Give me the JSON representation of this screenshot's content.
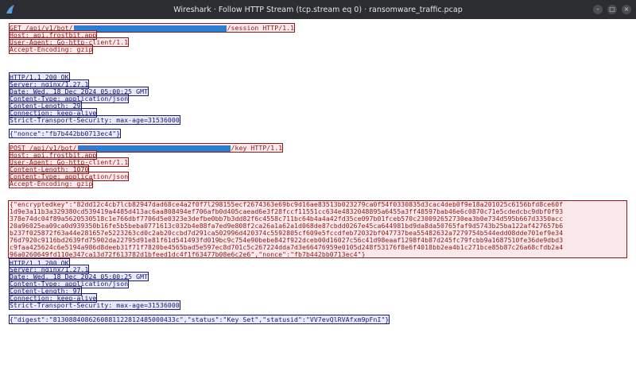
{
  "window": {
    "title": "Wireshark · Follow HTTP Stream (tcp.stream eq 0) · ransomware_traffic.pcap"
  },
  "req1": {
    "method_path_prefix": "GET /api/v1/bot/",
    "method_path_suffix": "/session HTTP/1.1",
    "host": "Host: api.frostbit.app",
    "ua": "User-Agent: Go-http-client/1.1",
    "enc": "Accept-Encoding: gzip"
  },
  "resp1": {
    "status": "HTTP/1.1 200 OK",
    "server": "Server: nginx/1.27.1",
    "date": "Date: Wed, 18 Dec 2024 05:00:25 GMT",
    "ctype": "Content-Type: application/json",
    "clen": "Content-Length: 29",
    "conn": "Connection: keep-alive",
    "sts": "Strict-Transport-Security: max-age=31536000",
    "body": "{\"nonce\":\"fb7b442bb0713ec4\"}"
  },
  "req2": {
    "method_path_prefix": "POST /api/v1/bot/",
    "method_path_suffix": "/key HTTP/1.1",
    "host": "Host: api.frostbit.app",
    "ua": "User-Agent: Go-http-client/1.1",
    "clen": "Content-Length: 1070",
    "ctype": "Content-Type: application/json",
    "enc": "Accept-Encoding: gzip",
    "body_lines": [
      "{\"encryptedkey\":\"82dd12c4cb7lcb82947dad68ce4a2f0f7l298155ecf2674363e69bc9d16ae83513b023279ca0f54f0330835d3cac4deb0f9e18a201025c6156bfd8ce60f",
      "1d9e3a11b3a329380cd539419a4485d413ac6aa808494ef706afb0d405caead6e3f28fccf11551cc634e4832048895a6455a3ff48597bab46e6c0870c71e5cdedcbc9dbf0f93",
      "378e74dc04f89a5620530518c1e766dbf7706d5e0323e3defbe0bb7b3dd82f6c4558c711bc64b4a4a42fd35ce097b01fceb570c230092652730ea3b0e734d595b667d3350acc",
      "20a96025ea09ca0d939350b16fe5b5beba0771613c032b4e88fa7ed9e808f2ca26a1a62a1d068de87cbdd0267e45ca644981bd9da8da50765faf9d5743b25ba122af427657b6",
      "b237f025872f63a44e281657e5223263cd0c2ab20ccbd7d291ca502996d420374c5592805cf609e5fccdfeb72032bf047737bea55482632a7279754b544edd08dde701ef9e34",
      "76d7920c9116bd2639fd75902da22795d91e81f61d541493fd019bc9c754e90bebe842f922dceb00d16027c56c41d98eaaf1298f4b87d245fc79fcbb9a1687510fe36de9dbd3",
      "c9faa425624c6e5194a986d8deeb31f71f7820be4565bad5e597ec8d701c5c267224dda7d3e66476959e0105d248f53176f8e6f4018bb2ea4b1c271bce85b87c26a68cfdb2a4",
      "96a0260649fd110e347ca13d72f613782d1bfeed1dc4f1f63477b08e6c2e6\",\"nonce\":\"fb7b442bb0713ec4\"}"
    ]
  },
  "resp2": {
    "status": "HTTP/1.1 200 OK",
    "server": "Server: nginx/1.27.1",
    "date": "Date: Wed, 18 Dec 2024 05:00:25 GMT",
    "ctype": "Content-Type: application/json",
    "clen": "Content-Length: 97",
    "conn": "Connection: keep-alive",
    "sts": "Strict-Transport-Security: max-age=31536000",
    "body": "{\"digest\":\"8130884086260881122812485000433c\",\"status\":\"Key Set\",\"statusid\":\"VV7evQlRVAfxm9pFnI\"}"
  },
  "colors": {
    "request": "#8b1a1a",
    "response": "#1a1a6e",
    "redaction": "#2a7fd4",
    "titlebar": "#2b2d30"
  }
}
